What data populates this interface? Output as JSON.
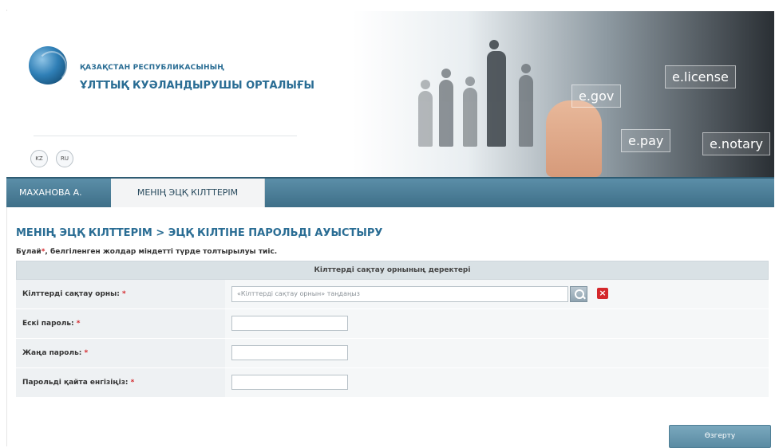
{
  "header": {
    "org_line1": "ҚАЗАҚСТАН РЕСПУБЛИКАСЫНЫҢ",
    "org_line2": "ҰЛТТЫҚ КУӘЛАНДЫРУШЫ ОРТАЛЫҒЫ",
    "lang_kz": "KZ",
    "lang_ru": "RU",
    "banner_tiles": {
      "egov": "e.gov",
      "elicense": "e.license",
      "epay": "e.pay",
      "enotary": "e.notary"
    }
  },
  "nav": {
    "user": "МАХАНОВА А.",
    "tab": "МЕНІҢ ЭЦҚ КІЛТТЕРІМ"
  },
  "page": {
    "title": "МЕНІҢ ЭЦҚ КІЛТТЕРІМ > ЭЦҚ КІЛТІНЕ ПАРОЛЬДІ АУЫСТЫРУ",
    "required_note_prefix": "Бұлай",
    "required_note_star": "*",
    "required_note_suffix": ", белгіленген жолдар міндетті түрде толтырылуы тиіс."
  },
  "form": {
    "section_title": "Кілттерді сақтау орнының деректері",
    "store_label": "Кілттерді сақтау орны:",
    "store_placeholder": "«Кілттерді сақтау орнын» таңдаңыз",
    "old_password_label": "Ескі пароль:",
    "new_password_label": "Жаңа пароль:",
    "repeat_password_label": "Парольді қайта енгізіңіз:",
    "required_star": "*",
    "clear_symbol": "×",
    "submit": "Өзгерту"
  },
  "colors": {
    "accent": "#2a6d94",
    "nav": "#4a7d96",
    "required": "#d4282c"
  }
}
